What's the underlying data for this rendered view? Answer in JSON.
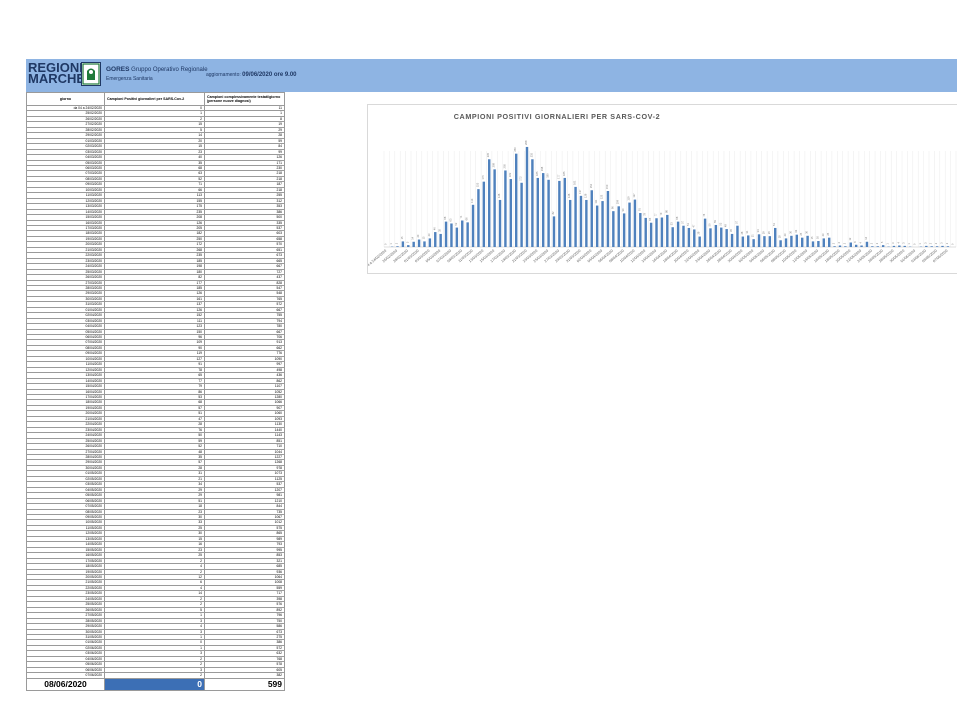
{
  "header": {
    "logo_line1": "REGIONE",
    "logo_line2": "MARCHE",
    "org_short": "GORES",
    "org_long": "Gruppo Operativo Regionale",
    "org_sub": "Emergenza Sanitaria",
    "update_label": "aggiornamento:",
    "update_value": "09/06/2020 ore 9.00"
  },
  "colors": {
    "header_bg": "#8eb4e3",
    "bar": "#4f81bd",
    "total_cell": "#3c6fb5"
  },
  "table": {
    "headers": [
      "giorno",
      "Campioni Positivi giornalieri per SARS-Cov-2",
      "Campioni complessivamente testati/giorno (persone nuove diagnosi)"
    ],
    "rows": [
      [
        "da 04 a 24/02/2020",
        "0",
        "11"
      ],
      [
        "25/02/2020",
        "1",
        "1"
      ],
      [
        "26/02/2020",
        "2",
        "8"
      ],
      [
        "27/02/2020",
        "15",
        "19"
      ],
      [
        "28/02/2020",
        "5",
        "29"
      ],
      [
        "29/02/2020",
        "14",
        "28"
      ],
      [
        "01/03/2020",
        "20",
        "59"
      ],
      [
        "02/03/2020",
        "15",
        "84"
      ],
      [
        "03/03/2020",
        "23",
        "99"
      ],
      [
        "04/03/2020",
        "40",
        "126"
      ],
      [
        "05/03/2020",
        "35",
        "171"
      ],
      [
        "06/03/2020",
        "68",
        "230"
      ],
      [
        "07/03/2020",
        "63",
        "218"
      ],
      [
        "08/03/2020",
        "52",
        "218"
      ],
      [
        "09/03/2020",
        "71",
        "187"
      ],
      [
        "10/03/2020",
        "66",
        "218"
      ],
      [
        "11/03/2020",
        "113",
        "255"
      ],
      [
        "12/03/2020",
        "155",
        "312"
      ],
      [
        "13/03/2020",
        "175",
        "353"
      ],
      [
        "14/03/2020",
        "235",
        "386"
      ],
      [
        "15/03/2020",
        "208",
        "500"
      ],
      [
        "16/03/2020",
        "126",
        "335"
      ],
      [
        "17/03/2020",
        "205",
        "537"
      ],
      [
        "18/03/2020",
        "182",
        "603"
      ],
      [
        "19/03/2020",
        "250",
        "658"
      ],
      [
        "20/03/2020",
        "172",
        "570"
      ],
      [
        "21/03/2020",
        "268",
        "651"
      ],
      [
        "22/03/2020",
        "235",
        "673"
      ],
      [
        "23/03/2020",
        "185",
        "665"
      ],
      [
        "24/03/2020",
        "198",
        "667"
      ],
      [
        "25/03/2020",
        "180",
        "727"
      ],
      [
        "26/03/2020",
        "82",
        "437"
      ],
      [
        "27/03/2020",
        "177",
        "828"
      ],
      [
        "28/03/2020",
        "185",
        "547"
      ],
      [
        "29/03/2020",
        "126",
        "548"
      ],
      [
        "30/03/2020",
        "161",
        "765"
      ],
      [
        "31/03/2020",
        "137",
        "572"
      ],
      [
        "01/04/2020",
        "126",
        "667"
      ],
      [
        "02/04/2020",
        "152",
        "755"
      ],
      [
        "03/04/2020",
        "111",
        "794"
      ],
      [
        "04/04/2020",
        "123",
        "780"
      ],
      [
        "05/04/2020",
        "150",
        "667"
      ],
      [
        "06/04/2020",
        "96",
        "706"
      ],
      [
        "07/04/2020",
        "109",
        "913"
      ],
      [
        "08/04/2020",
        "90",
        "662"
      ],
      [
        "09/04/2020",
        "119",
        "776"
      ],
      [
        "10/04/2020",
        "127",
        "1090"
      ],
      [
        "11/04/2020",
        "91",
        "997"
      ],
      [
        "12/04/2020",
        "78",
        "498"
      ],
      [
        "13/04/2020",
        "65",
        "436"
      ],
      [
        "14/04/2020",
        "77",
        "862"
      ],
      [
        "15/04/2020",
        "79",
        "1107"
      ],
      [
        "16/04/2020",
        "86",
        "1052"
      ],
      [
        "17/04/2020",
        "53",
        "1280"
      ],
      [
        "18/04/2020",
        "68",
        "1066"
      ],
      [
        "19/04/2020",
        "57",
        "907"
      ],
      [
        "20/04/2020",
        "51",
        "1060"
      ],
      [
        "21/04/2020",
        "47",
        "1093"
      ],
      [
        "22/04/2020",
        "28",
        "1130"
      ],
      [
        "23/04/2020",
        "76",
        "1440"
      ],
      [
        "24/04/2020",
        "50",
        "1143"
      ],
      [
        "25/04/2020",
        "59",
        "851"
      ],
      [
        "26/04/2020",
        "52",
        "710"
      ],
      [
        "27/04/2020",
        "48",
        "1044"
      ],
      [
        "28/04/2020",
        "35",
        "1227"
      ],
      [
        "29/04/2020",
        "57",
        "1268"
      ],
      [
        "30/04/2020",
        "28",
        "978"
      ],
      [
        "01/05/2020",
        "31",
        "1073"
      ],
      [
        "02/05/2020",
        "21",
        "1125"
      ],
      [
        "03/05/2020",
        "34",
        "537"
      ],
      [
        "04/05/2020",
        "29",
        "1207"
      ],
      [
        "05/05/2020",
        "29",
        "981"
      ],
      [
        "06/05/2020",
        "51",
        "1210"
      ],
      [
        "07/05/2020",
        "18",
        "844"
      ],
      [
        "08/05/2020",
        "23",
        "735"
      ],
      [
        "09/05/2020",
        "30",
        "1067"
      ],
      [
        "10/05/2020",
        "33",
        "1012"
      ],
      [
        "11/05/2020",
        "25",
        "575"
      ],
      [
        "12/05/2020",
        "30",
        "865"
      ],
      [
        "13/05/2020",
        "15",
        "989"
      ],
      [
        "14/05/2020",
        "16",
        "793"
      ],
      [
        "15/05/2020",
        "23",
        "995"
      ],
      [
        "16/05/2020",
        "25",
        "853"
      ],
      [
        "17/05/2020",
        "2",
        "321"
      ],
      [
        "18/05/2020",
        "4",
        "685"
      ],
      [
        "19/05/2020",
        "2",
        "936"
      ],
      [
        "20/05/2020",
        "12",
        "1064"
      ],
      [
        "21/05/2020",
        "6",
        "1008"
      ],
      [
        "22/05/2020",
        "4",
        "559"
      ],
      [
        "23/05/2020",
        "14",
        "717"
      ],
      [
        "24/05/2020",
        "2",
        "398"
      ],
      [
        "25/05/2020",
        "2",
        "576"
      ],
      [
        "26/05/2020",
        "5",
        "892"
      ],
      [
        "27/05/2020",
        "1",
        "796"
      ],
      [
        "28/05/2020",
        "3",
        "750"
      ],
      [
        "29/05/2020",
        "4",
        "586"
      ],
      [
        "30/05/2020",
        "3",
        "673"
      ],
      [
        "31/05/2020",
        "1",
        "275"
      ],
      [
        "01/06/2020",
        "0",
        "386"
      ],
      [
        "02/06/2020",
        "1",
        "572"
      ],
      [
        "03/06/2020",
        "3",
        "632"
      ],
      [
        "04/06/2020",
        "2",
        "768"
      ],
      [
        "05/06/2020",
        "2",
        "578"
      ],
      [
        "06/06/2020",
        "3",
        "605"
      ],
      [
        "07/06/2020",
        "2",
        "382"
      ]
    ],
    "total_row": {
      "date": "08/06/2020",
      "positives": "0",
      "tested": "599"
    }
  },
  "chart_data": {
    "type": "bar",
    "title": "CAMPIONI POSITIVI GIORNALIERI PER SARS-COV-2",
    "categories": [
      "da 04 a 24/02/2020",
      "25/02/2020",
      "26/02/2020",
      "27/02/2020",
      "28/02/2020",
      "29/02/2020",
      "01/03/2020",
      "02/03/2020",
      "03/03/2020",
      "04/03/2020",
      "05/03/2020",
      "06/03/2020",
      "07/03/2020",
      "08/03/2020",
      "09/03/2020",
      "10/03/2020",
      "11/03/2020",
      "12/03/2020",
      "13/03/2020",
      "14/03/2020",
      "15/03/2020",
      "16/03/2020",
      "17/03/2020",
      "18/03/2020",
      "19/03/2020",
      "20/03/2020",
      "21/03/2020",
      "22/03/2020",
      "23/03/2020",
      "24/03/2020",
      "25/03/2020",
      "26/03/2020",
      "27/03/2020",
      "28/03/2020",
      "29/03/2020",
      "30/03/2020",
      "31/03/2020",
      "01/04/2020",
      "02/04/2020",
      "03/04/2020",
      "04/04/2020",
      "05/04/2020",
      "06/04/2020",
      "07/04/2020",
      "08/04/2020",
      "09/04/2020",
      "10/04/2020",
      "11/04/2020",
      "12/04/2020",
      "13/04/2020",
      "14/04/2020",
      "15/04/2020",
      "16/04/2020",
      "17/04/2020",
      "18/04/2020",
      "19/04/2020",
      "20/04/2020",
      "21/04/2020",
      "22/04/2020",
      "23/04/2020",
      "24/04/2020",
      "25/04/2020",
      "26/04/2020",
      "27/04/2020",
      "28/04/2020",
      "29/04/2020",
      "30/04/2020",
      "01/05/2020",
      "02/05/2020",
      "03/05/2020",
      "04/05/2020",
      "05/05/2020",
      "06/05/2020",
      "07/05/2020",
      "08/05/2020",
      "09/05/2020",
      "10/05/2020",
      "11/05/2020",
      "12/05/2020",
      "13/05/2020",
      "14/05/2020",
      "15/05/2020",
      "16/05/2020",
      "17/05/2020",
      "18/05/2020",
      "19/05/2020",
      "20/05/2020",
      "21/05/2020",
      "22/05/2020",
      "23/05/2020",
      "24/05/2020",
      "25/05/2020",
      "26/05/2020",
      "27/05/2020",
      "28/05/2020",
      "29/05/2020",
      "30/05/2020",
      "31/05/2020",
      "01/06/2020",
      "02/06/2020",
      "03/06/2020",
      "04/06/2020",
      "05/06/2020",
      "06/06/2020",
      "07/06/2020",
      "08/06/2020"
    ],
    "values": [
      0,
      1,
      2,
      15,
      5,
      14,
      20,
      15,
      23,
      40,
      35,
      68,
      63,
      52,
      71,
      66,
      113,
      155,
      175,
      235,
      208,
      126,
      205,
      182,
      250,
      172,
      268,
      235,
      185,
      198,
      180,
      82,
      177,
      185,
      126,
      161,
      137,
      126,
      152,
      111,
      123,
      150,
      96,
      109,
      90,
      119,
      127,
      91,
      78,
      65,
      77,
      79,
      86,
      53,
      68,
      57,
      51,
      47,
      28,
      76,
      50,
      59,
      52,
      48,
      35,
      57,
      28,
      31,
      21,
      34,
      29,
      29,
      51,
      18,
      23,
      30,
      33,
      25,
      30,
      15,
      16,
      23,
      25,
      2,
      4,
      2,
      12,
      6,
      4,
      14,
      2,
      2,
      5,
      1,
      3,
      4,
      3,
      1,
      0,
      1,
      3,
      2,
      2,
      3,
      2,
      0
    ],
    "ylim": [
      0,
      300
    ],
    "grid": true,
    "legend": "none"
  }
}
